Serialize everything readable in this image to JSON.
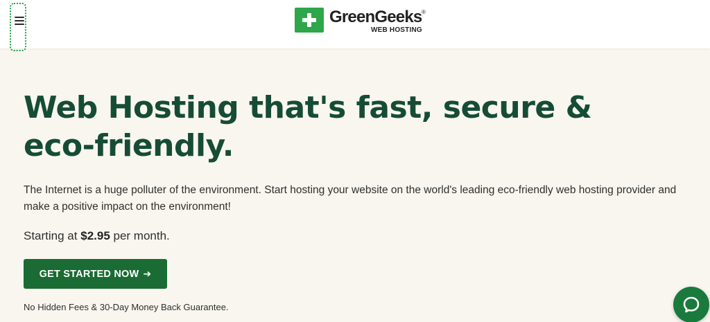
{
  "header": {
    "menu_icon": "hamburger-menu-icon",
    "logo": {
      "text": "GreenGeeks",
      "registered_mark": "®",
      "subtitle": "WEB HOSTING",
      "mark_icon": "plus-icon",
      "brand_color": "#2ea64a"
    }
  },
  "hero": {
    "headline": "Web Hosting that's fast, secure & eco-friendly.",
    "description": "The Internet is a huge polluter of the environment. Start hosting your website on the world's leading eco-friendly web hosting provider and make a positive impact on the environment!",
    "pricing": {
      "prefix": "Starting at",
      "price": "$2.95",
      "suffix": "per month."
    },
    "cta": {
      "label": "GET STARTED NOW",
      "arrow": "➔",
      "color": "#1a6b34"
    },
    "guarantee": "No Hidden Fees & 30-Day Money Back Guarantee."
  },
  "chat": {
    "icon": "chat-bubble-icon",
    "color": "#1a7a3c"
  },
  "colors": {
    "background": "#f8f6ee",
    "headline": "#164c36",
    "header_bg": "#ffffff"
  }
}
